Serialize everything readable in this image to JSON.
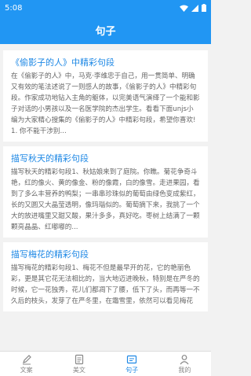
{
  "status": {
    "time": "5:08"
  },
  "header": {
    "title": "句子"
  },
  "cards": [
    {
      "title": "《偷影子的人》中精彩句段",
      "body": "在《偷影子的人》中，马克·李维忠于自己，用一贯简单、明确又有效的笔法述说了一则感人的故事，《偷影子的人》中精彩句段。作家成功地钻入主角的躯体，以完美语气演绎了一个能和影子对话的小男孩以及一名医学院的杰出学生。看看下面unjs小编为大家精心搜集的《偷影子的人》中精彩句段，希望你喜欢!1. 你不能干涉别..."
    },
    {
      "title": "描写秋天的精彩句段",
      "body": "描写秋天的精彩句段1、秋姑娘来到了庭院。你瞧。菊花争奇斗艳，红的像火、黄的像金、粉的像霞，白的像雪。走进果园，看到了多么丰营养的鸭梨；一串串珍珠似的葡萄由绿色变成紫红，长的又圆又大晶莹透明，像玛瑙似的。葡萄摘下来，我挑了一个大的放进嘴里又甜又酸，果汁多多，真好吃。枣树上结满了一颗颗亮晶晶、红嘟嘟的..."
    },
    {
      "title": "描写梅花的精彩句段",
      "body": "描写梅花的精彩句段1、梅花不但是最早开的花，它的艳丽色彩，更是其它花无法相比的，当大地迈进晚秋，特别是在严冬的时候，它一花独秀，花儿们都凋下了腰，低下了头，而再等一不久后的枝头，发芽了在严冬里，在霜雪里，依然可以看见梅花"
    }
  ],
  "tabs": [
    {
      "label": "文案",
      "icon": "pen-icon"
    },
    {
      "label": "美文",
      "icon": "document-icon"
    },
    {
      "label": "句子",
      "icon": "quote-card-icon"
    },
    {
      "label": "我的",
      "icon": "person-icon"
    }
  ],
  "colors": {
    "primary": "#2196f3",
    "active_tab": "#1e88e5"
  }
}
